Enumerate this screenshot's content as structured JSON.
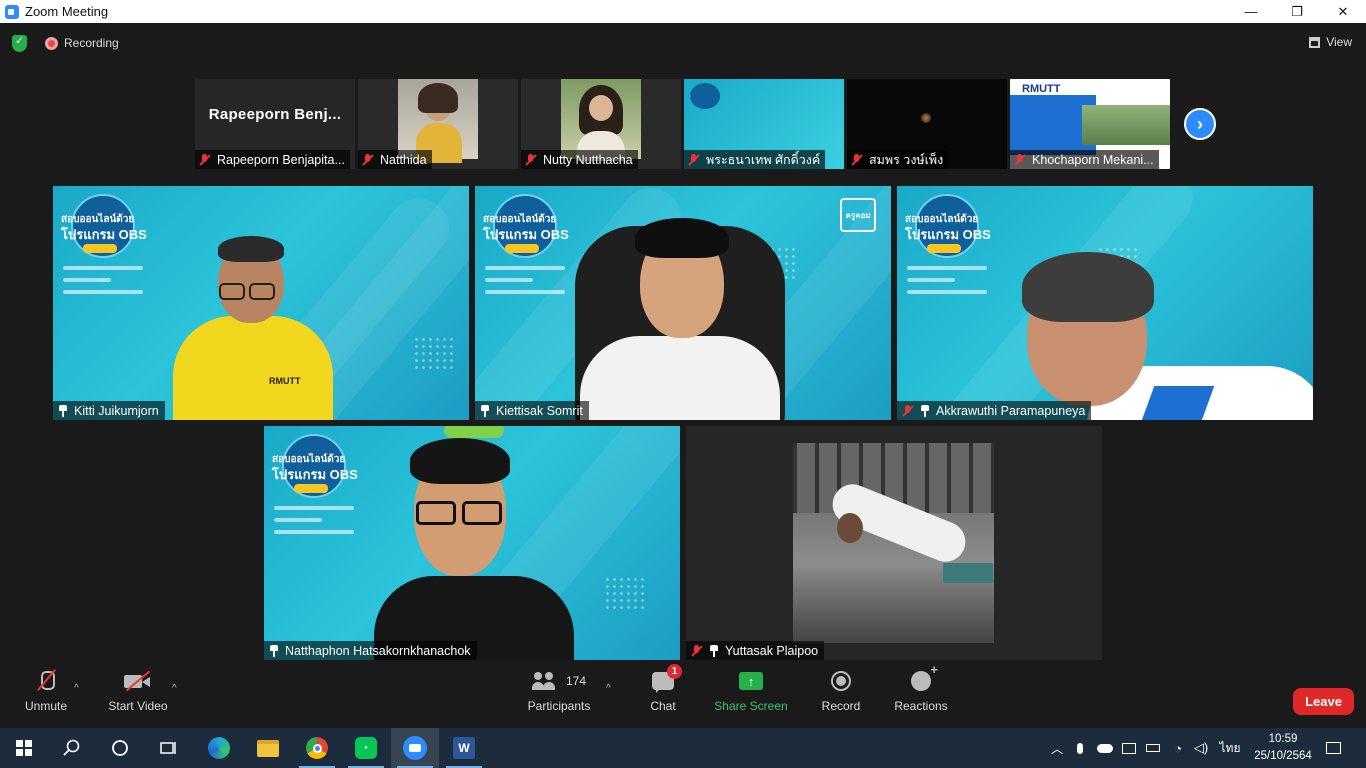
{
  "window": {
    "title": "Zoom Meeting",
    "minimize": "—",
    "maximize": "❐",
    "close": "✕"
  },
  "topbar": {
    "recording_label": "Recording",
    "view_label": "View"
  },
  "thumbnails": [
    {
      "name": "Rapeeporn Benjapita...",
      "display_name": "Rapeeporn  Benj...",
      "muted": true
    },
    {
      "name": "Natthida",
      "muted": true
    },
    {
      "name": "Nutty Nutthacha",
      "muted": true
    },
    {
      "name": "พระธนาเทพ ศักดิ์วงค์",
      "muted": true
    },
    {
      "name": "สมพร วงษ์เพ็ง",
      "muted": true
    },
    {
      "name": "Khochaporn Mekani...",
      "muted": true
    }
  ],
  "thumb_slide": {
    "logo": "RMUTT"
  },
  "tiles": [
    {
      "name": "Kitti Juikumjorn",
      "muted": false,
      "pinned": true,
      "banner_line1": "สอบออนไลน์ด้วย",
      "banner_line2": "โปรแกรม OBS",
      "shirt_logo": "RMUTT"
    },
    {
      "name": "Kiettisak Somrit",
      "muted": false,
      "pinned": true,
      "banner_line1": "สอบออนไลน์ด้วย",
      "banner_line2": "โปรแกรม OBS",
      "corner_badge": "ครูคอม"
    },
    {
      "name": "Akkrawuthi Paramapuneya",
      "muted": true,
      "pinned": true,
      "banner_line1": "สอบออนไลน์ด้วย",
      "banner_line2": "โปรแกรม OBS"
    },
    {
      "name": "Natthaphon Hatsakornkhanachok",
      "muted": false,
      "pinned": true,
      "banner_line1": "สอบออนไลน์ด้วย",
      "banner_line2": "โปรแกรม OBS"
    },
    {
      "name": "Yuttasak Plaipoo",
      "muted": true,
      "pinned": true
    }
  ],
  "toolbar": {
    "unmute": "Unmute",
    "start_video": "Start Video",
    "participants": "Participants",
    "participants_count": "174",
    "chat": "Chat",
    "chat_badge": "1",
    "share_screen": "Share Screen",
    "record": "Record",
    "reactions": "Reactions",
    "leave": "Leave",
    "caret": "^"
  },
  "taskbar": {
    "time": "10:59",
    "date": "25/10/2564",
    "language": "ไทย",
    "apps": [
      "start-icon",
      "search-icon",
      "cortana-icon",
      "task-view-icon",
      "edge-icon",
      "file-explorer-icon",
      "chrome-icon",
      "line-icon",
      "zoom-icon",
      "word-icon"
    ]
  },
  "colors": {
    "accent": "#2d8cff",
    "share_green": "#25b04a",
    "leave_red": "#e02828",
    "tile_teal": "#23b3cf"
  }
}
